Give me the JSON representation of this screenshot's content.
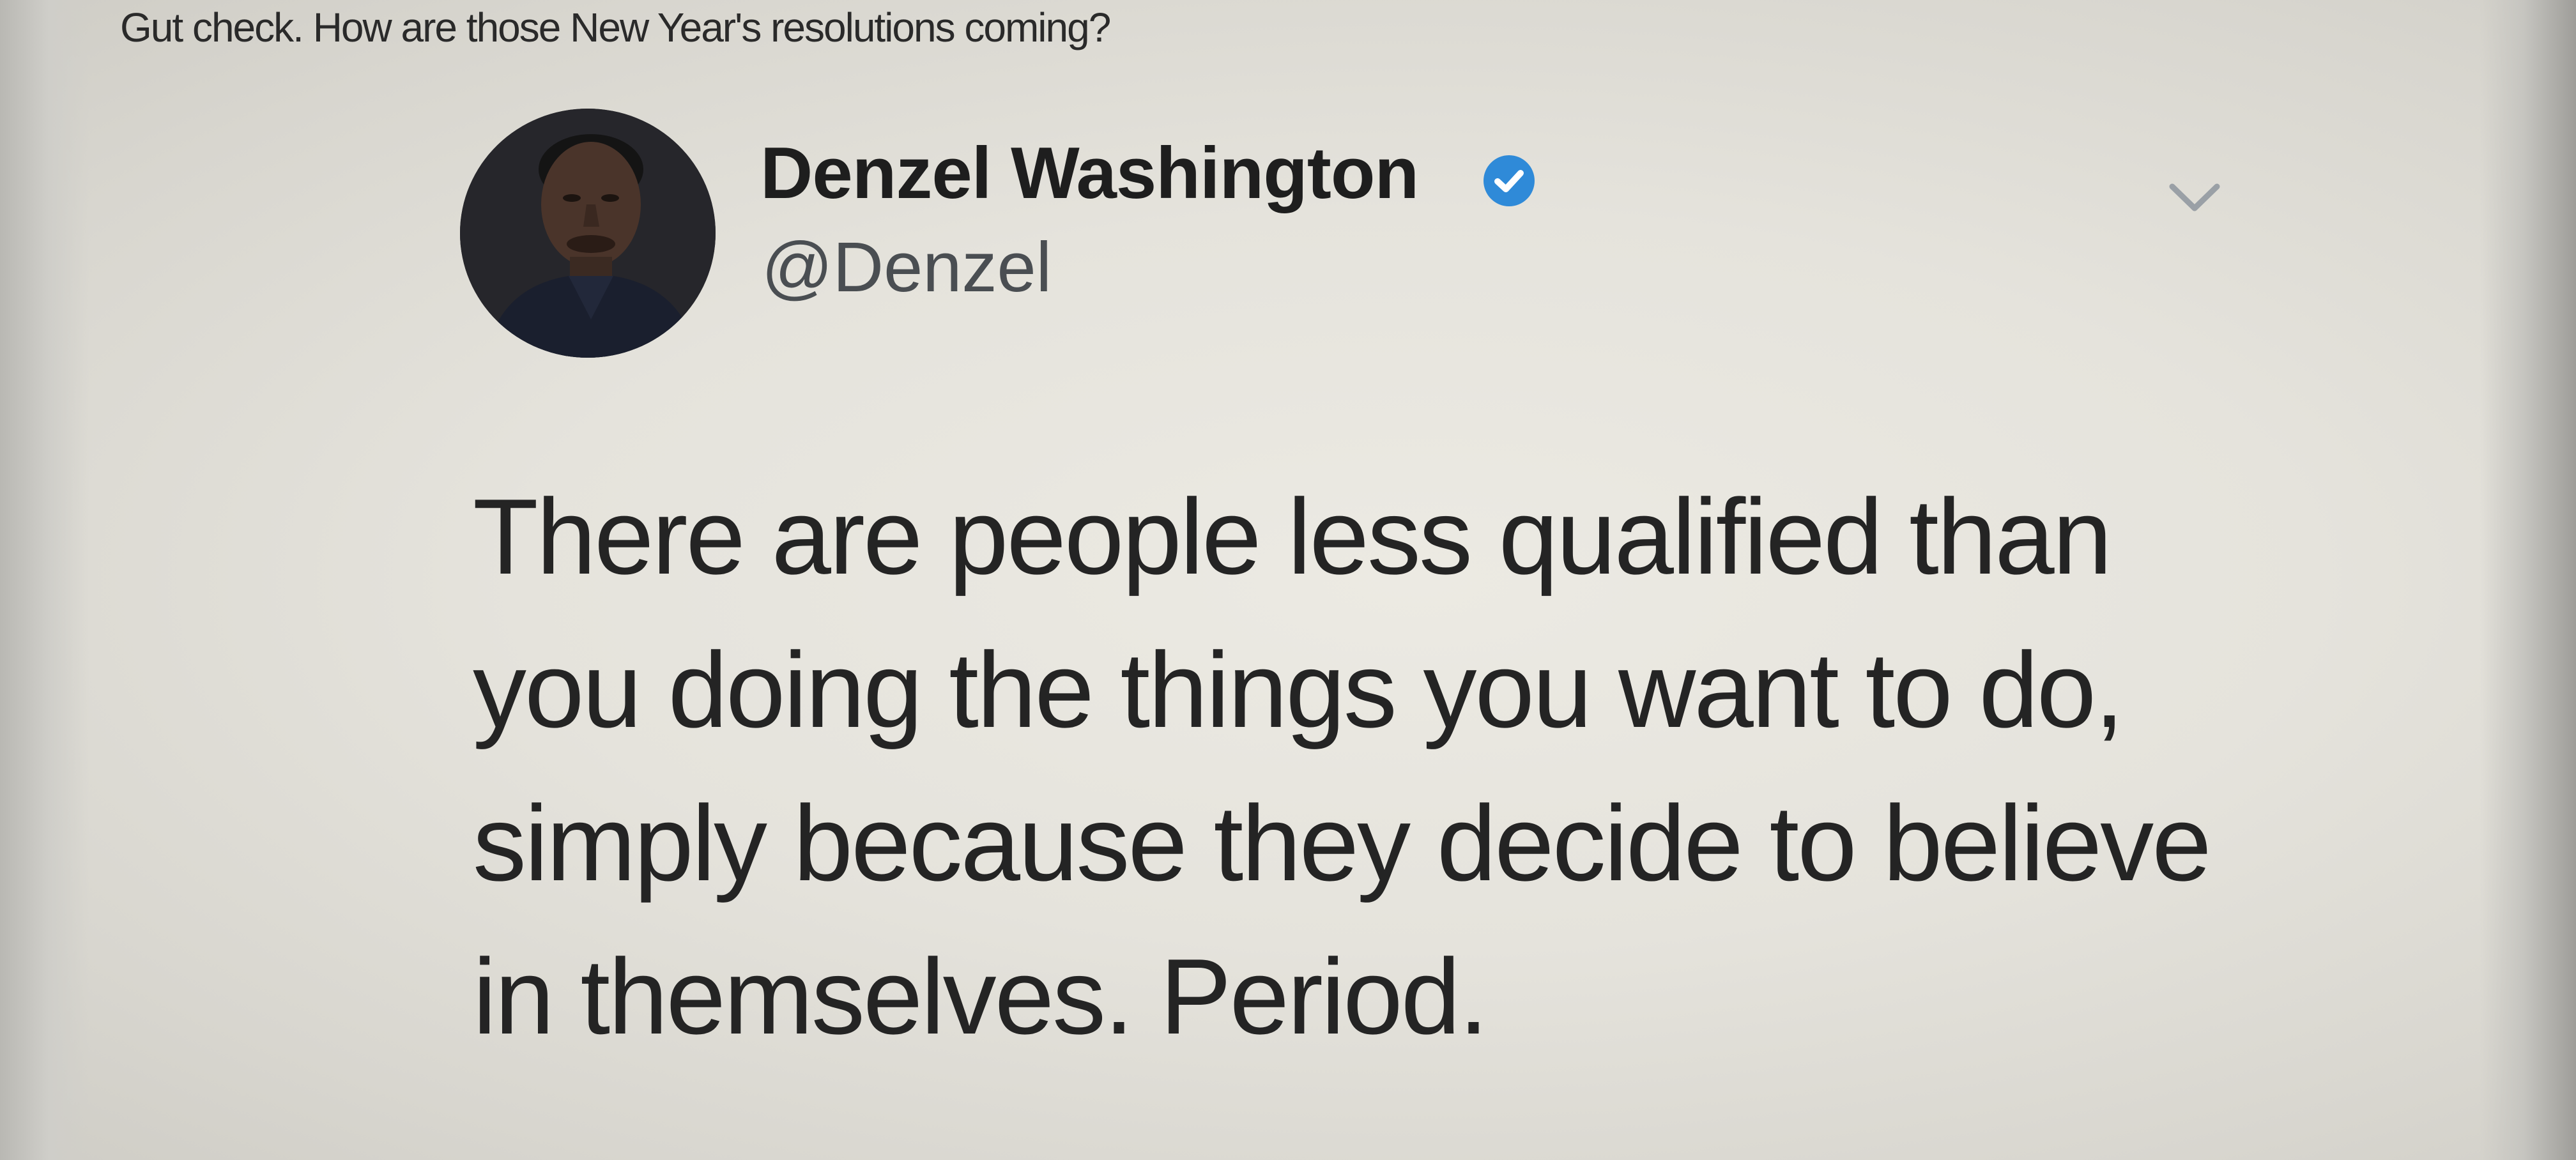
{
  "header": {
    "text": "Gut check. How are those New Year's resolutions coming?"
  },
  "tweet": {
    "author": {
      "display_name": "Denzel Washington",
      "handle": "@Denzel",
      "verified": true
    },
    "lines": [
      "There are people less qualified than",
      "you doing the things you want to do,",
      "simply because they decide to believe",
      "in themselves. Period."
    ]
  },
  "icons": {
    "verified": "verified-badge-icon",
    "menu": "chevron-down-icon"
  },
  "colors": {
    "verified_blue": "#2f8ad8",
    "text_primary": "#242424",
    "text_secondary": "#4a4e52"
  }
}
